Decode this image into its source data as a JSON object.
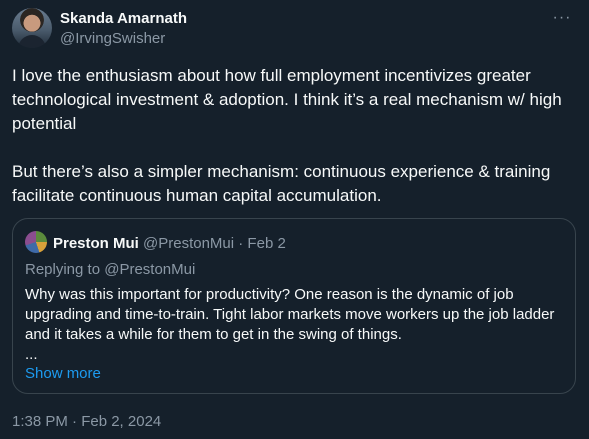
{
  "author": {
    "name": "Skanda Amarnath",
    "handle": "@IrvingSwisher"
  },
  "more_label": "···",
  "body": "I love the enthusiasm about how full employment incentivizes greater technological investment & adoption. I think it’s a real mechanism w/ high potential\n\nBut there’s also a simpler mechanism: continuous experience & training facilitate continuous human capital accumulation.",
  "quote": {
    "name": "Preston Mui",
    "handle_date": " @PrestonMui · Feb 2",
    "replying_to": "Replying to @PrestonMui",
    "text": "Why was this important for productivity? One reason is the dynamic of job upgrading and time-to-train. Tight labor markets move workers up the job ladder and it takes a while for them to get in the swing of things.",
    "ellipsis": "...",
    "show_more": "Show more"
  },
  "timestamp": "1:38 PM · Feb 2, 2024"
}
